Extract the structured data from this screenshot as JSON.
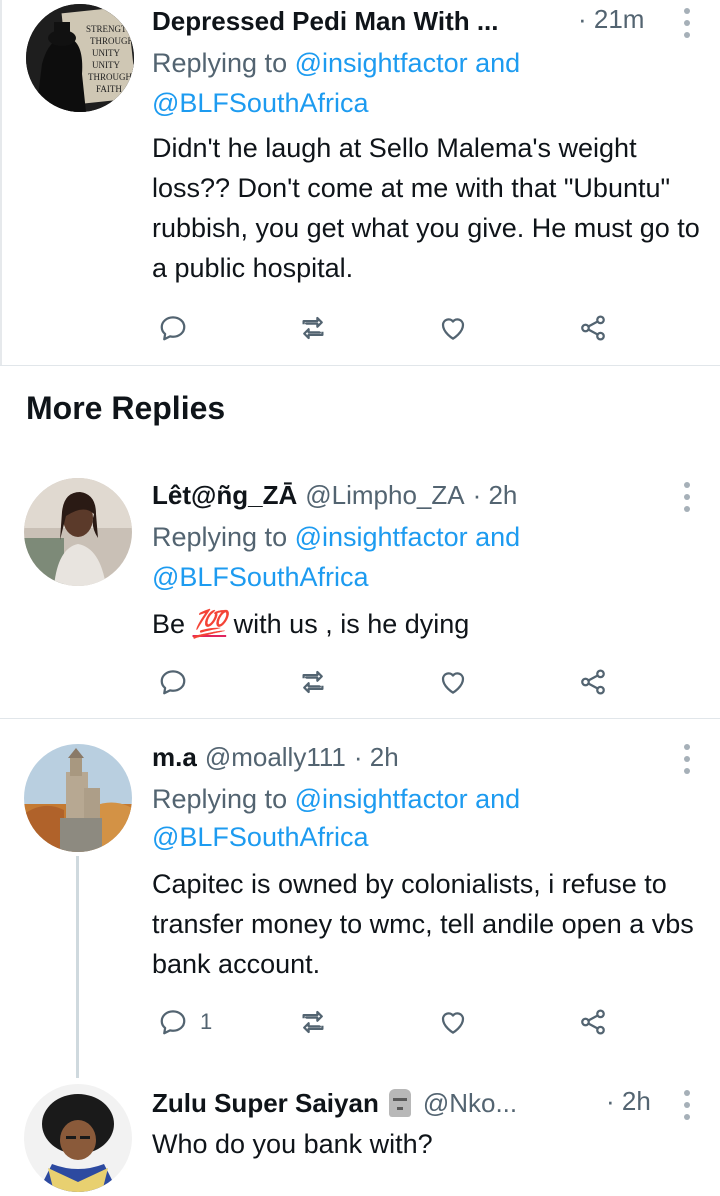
{
  "tweets": [
    {
      "name": "Depressed Pedi Man With ...",
      "handle": "",
      "time": "· 21m",
      "replying_prefix": "Replying to ",
      "replying_to_1": "@insightfactor and",
      "replying_to_2": "@BLFSouthAfrica",
      "text": "Didn't he laugh at Sello Malema's weight loss?? Don't come at me with that \"Ubuntu\" rubbish, you get what you give. He must go to a public hospital.",
      "avatar_text": [
        "STRENGTH",
        "THROUGH",
        "UNITY",
        "UNITY",
        "THROUGH",
        "FAITH"
      ],
      "reply_count": "",
      "avatar_icon": "poster-avatar"
    },
    {
      "name": "Lêt@ñg_ZĀ",
      "handle": "@Limpho_ZA",
      "time": "· 2h",
      "replying_prefix": "Replying to ",
      "replying_to_1": "@insightfactor and",
      "replying_to_2": "@BLFSouthAfrica",
      "text_before": "Be ",
      "emoji": "💯",
      "text_after": " with us , is he dying",
      "reply_count": ""
    },
    {
      "name": "m.a",
      "handle": "@moally111",
      "time": "· 2h",
      "replying_prefix": "Replying to ",
      "replying_to_1": "@insightfactor and",
      "replying_to_2": "@BLFSouthAfrica",
      "text": "Capitec is owned by colonialists, i refuse to transfer money to wmc, tell andile open a vbs bank account.",
      "reply_count": "1"
    },
    {
      "name": "Zulu Super Saiyan",
      "handle": "@Nko...",
      "time": "· 2h",
      "badge_icon": "moai-emoji-icon",
      "text": "Who do you bank with?"
    }
  ],
  "section": {
    "more_replies": "More Replies"
  },
  "colors": {
    "link": "#1d9bf0",
    "secondary": "#536471",
    "primary": "#0f1419",
    "divider": "#e1e6ea"
  }
}
